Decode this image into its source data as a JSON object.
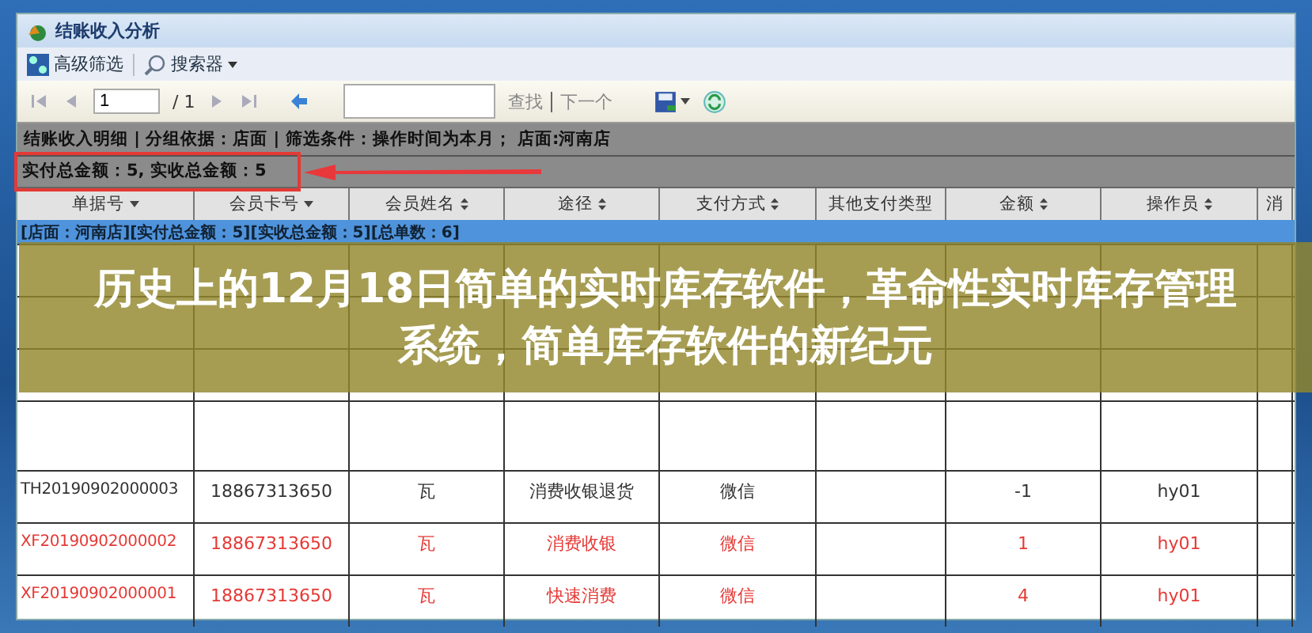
{
  "window": {
    "title": "结账收入分析"
  },
  "toolbar": [
    {
      "label": "高级筛选",
      "kind": "filter",
      "dropdown": false
    },
    {
      "label": "搜索器",
      "kind": "search",
      "dropdown": true
    }
  ],
  "pager": {
    "page": "1",
    "total": "/ 1",
    "find": "查找",
    "next": "下一个"
  },
  "info": "结账收入明细 | 分组依据：店面 | 筛选条件：操作时间为本月； 店面:河南店",
  "totals": {
    "text": "实付总金额：5, 实收总金额：5",
    "highlighted": true
  },
  "columns": [
    {
      "label": "单据号",
      "menu": true,
      "sortable": false
    },
    {
      "label": "会员卡号",
      "menu": true,
      "sortable": false
    },
    {
      "label": "会员姓名",
      "menu": false,
      "sortable": true
    },
    {
      "label": "途径",
      "menu": false,
      "sortable": true
    },
    {
      "label": "支付方式",
      "menu": false,
      "sortable": true
    },
    {
      "label": "其他支付类型",
      "menu": false,
      "sortable": false
    },
    {
      "label": "金额",
      "menu": false,
      "sortable": true
    },
    {
      "label": "操作员",
      "menu": false,
      "sortable": true
    },
    {
      "label": "消",
      "menu": false,
      "sortable": false
    }
  ],
  "group": "[店面：河南店][实付总金额：5][实收总金额：5][总单数：6]",
  "rows": [
    {
      "kind": "covered"
    },
    {
      "kind": "covered"
    },
    {
      "kind": "covered"
    },
    {
      "kind": "blank"
    },
    {
      "kind": "record",
      "voided": false,
      "cells": [
        "TH20190902000003",
        "18867313650",
        "瓦",
        "消费收银退货",
        "微信",
        "",
        "-1",
        "hy01",
        ""
      ]
    },
    {
      "kind": "record",
      "voided": true,
      "cells": [
        "XF20190902000002",
        "18867313650",
        "瓦",
        "消费收银",
        "微信",
        "",
        "1",
        "hy01",
        ""
      ]
    },
    {
      "kind": "record",
      "voided": true,
      "cells": [
        "XF20190902000001",
        "18867313650",
        "瓦",
        "快速消费",
        "微信",
        "",
        "4",
        "hy01",
        ""
      ]
    }
  ],
  "banner": {
    "title": "历史上的12月18日简单的实时库存软件，革命性实时库存管理系统，简单库存软件的新纪元"
  }
}
